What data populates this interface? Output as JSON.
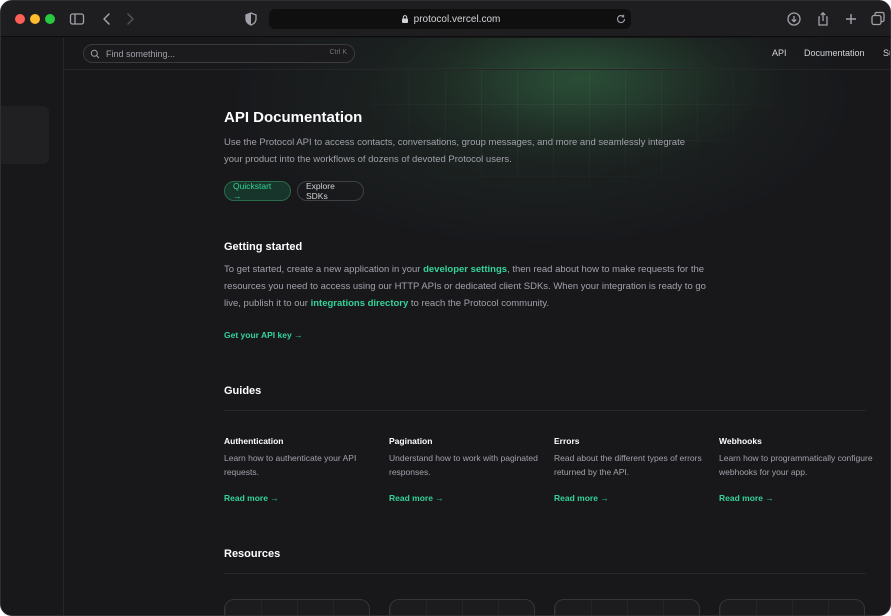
{
  "browser": {
    "url": "protocol.vercel.com"
  },
  "topnav": {
    "search_placeholder": "Find something...",
    "search_shortcut": "Ctrl K",
    "links": [
      "API",
      "Documentation",
      "Su"
    ]
  },
  "hero": {
    "title": "API Documentation",
    "description": "Use the Protocol API to access contacts, conversations, group messages, and more and seamlessly integrate your product into the workflows of dozens of devoted Protocol users.",
    "primary_button": "Quickstart →",
    "secondary_button": "Explore SDKs"
  },
  "getting_started": {
    "heading": "Getting started",
    "text_1": "To get started, create a new application in your ",
    "link_1": "developer settings",
    "text_2": ", then read about how to make requests for the resources you need to access using our HTTP APIs or dedicated client SDKs. When your integration is ready to go live, publish it to our ",
    "link_2": "integrations directory",
    "text_3": " to reach the Protocol community.",
    "cta": "Get your API key →"
  },
  "guides": {
    "heading": "Guides",
    "items": [
      {
        "title": "Authentication",
        "description": "Learn how to authenticate your API requests.",
        "link": "Read more →"
      },
      {
        "title": "Pagination",
        "description": "Understand how to work with paginated responses.",
        "link": "Read more →"
      },
      {
        "title": "Errors",
        "description": "Read about the different types of errors returned by the API.",
        "link": "Read more →"
      },
      {
        "title": "Webhooks",
        "description": "Learn how to programmatically configure webhooks for your app.",
        "link": "Read more →"
      }
    ]
  },
  "resources": {
    "heading": "Resources"
  },
  "colors": {
    "accent": "#34d399",
    "background": "#18181b"
  }
}
